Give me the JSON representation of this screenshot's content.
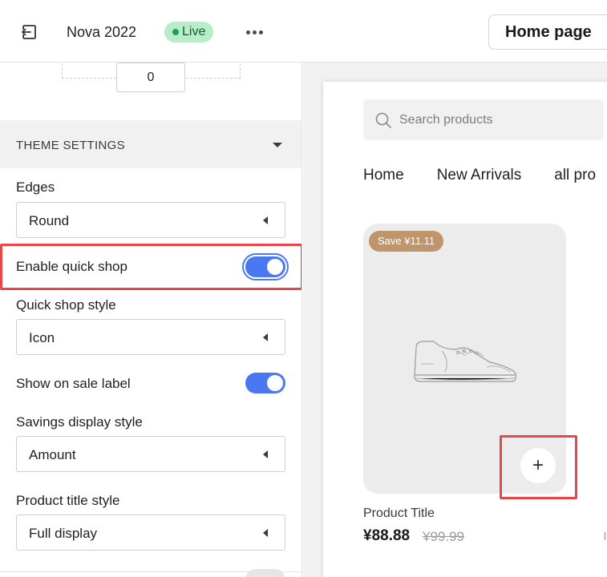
{
  "topbar": {
    "store_name": "Nova 2022",
    "status_badge": "Live",
    "page_selector": "Home page"
  },
  "panel": {
    "number_value": "0",
    "section_title": "THEME SETTINGS",
    "fields": {
      "edges": {
        "label": "Edges",
        "value": "Round"
      },
      "quick_shop": {
        "label": "Enable quick shop",
        "enabled": true
      },
      "quick_shop_style": {
        "label": "Quick shop style",
        "value": "Icon"
      },
      "sale_label": {
        "label": "Show on sale label",
        "enabled": true
      },
      "savings_style": {
        "label": "Savings display style",
        "value": "Amount"
      },
      "title_style": {
        "label": "Product title style",
        "value": "Full display"
      }
    }
  },
  "preview": {
    "search_placeholder": "Search products",
    "nav": [
      "Home",
      "New Arrivals",
      "all pro"
    ],
    "product": {
      "badge": "Save ¥11.11",
      "title": "Product Title",
      "price": "¥88.88",
      "compare_price": "¥99.99"
    }
  },
  "colors": {
    "accent": "#4a78f0",
    "highlight": "#e8474a",
    "live_badge": "#b9ecc9",
    "sale_badge": "#c0956b"
  },
  "icons": {
    "exit": "exit-icon",
    "more": "more-icon",
    "search": "search-icon",
    "shoe": "shoe-icon",
    "plus": "plus-icon"
  }
}
